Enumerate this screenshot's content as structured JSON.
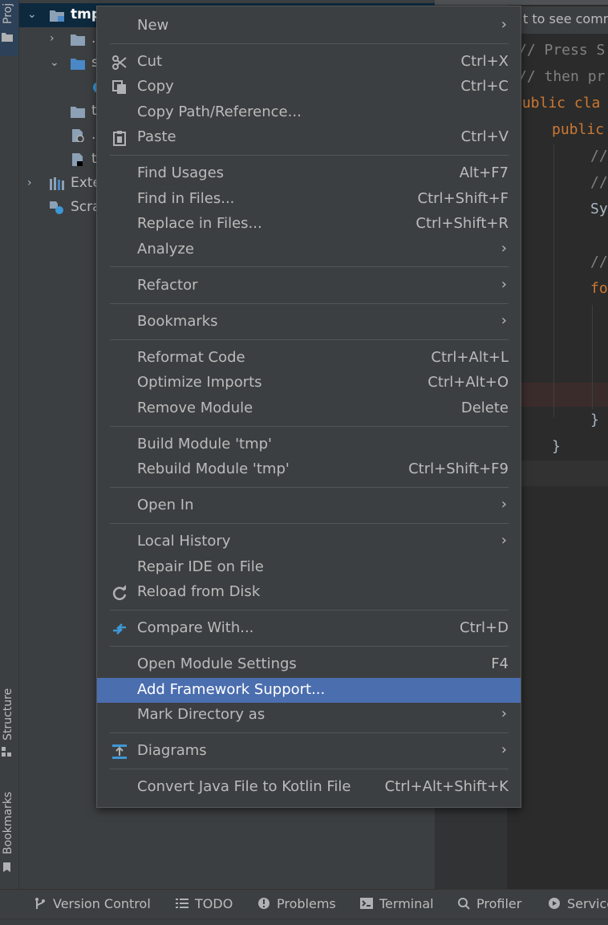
{
  "left_strip": {
    "project_label": "Proj",
    "structure_label": "Structure",
    "bookmarks_label": "Bookmarks"
  },
  "project_tree": {
    "root_label": "tmp",
    "row_idea": ".",
    "row_src": "s",
    "row_out": "t",
    "row_iml": ".",
    "row_tmp_file": "t",
    "external_libraries": "Exte",
    "scratches": "Scra"
  },
  "editor": {
    "hint": "t to see comm",
    "lines": [
      "// Press S",
      "// then pr",
      "public cla",
      "public",
      "//",
      "//",
      "Sy",
      "//",
      "fo",
      "}",
      "}"
    ]
  },
  "context_menu": {
    "items": [
      {
        "label": "New",
        "shortcut": "",
        "submenu": true,
        "icon": ""
      },
      {
        "label": "Cut",
        "shortcut": "Ctrl+X",
        "submenu": false,
        "icon": "scissors-icon"
      },
      {
        "label": "Copy",
        "shortcut": "Ctrl+C",
        "submenu": false,
        "icon": "copy-icon"
      },
      {
        "label": "Copy Path/Reference...",
        "shortcut": "",
        "submenu": false,
        "icon": ""
      },
      {
        "label": "Paste",
        "shortcut": "Ctrl+V",
        "submenu": false,
        "icon": "clipboard-icon"
      },
      {
        "label": "Find Usages",
        "shortcut": "Alt+F7",
        "submenu": false,
        "icon": ""
      },
      {
        "label": "Find in Files...",
        "shortcut": "Ctrl+Shift+F",
        "submenu": false,
        "icon": ""
      },
      {
        "label": "Replace in Files...",
        "shortcut": "Ctrl+Shift+R",
        "submenu": false,
        "icon": ""
      },
      {
        "label": "Analyze",
        "shortcut": "",
        "submenu": true,
        "icon": ""
      },
      {
        "label": "Refactor",
        "shortcut": "",
        "submenu": true,
        "icon": ""
      },
      {
        "label": "Bookmarks",
        "shortcut": "",
        "submenu": true,
        "icon": ""
      },
      {
        "label": "Reformat Code",
        "shortcut": "Ctrl+Alt+L",
        "submenu": false,
        "icon": ""
      },
      {
        "label": "Optimize Imports",
        "shortcut": "Ctrl+Alt+O",
        "submenu": false,
        "icon": ""
      },
      {
        "label": "Remove Module",
        "shortcut": "Delete",
        "submenu": false,
        "icon": ""
      },
      {
        "label": "Build Module 'tmp'",
        "shortcut": "",
        "submenu": false,
        "icon": ""
      },
      {
        "label": "Rebuild Module 'tmp'",
        "shortcut": "Ctrl+Shift+F9",
        "submenu": false,
        "icon": ""
      },
      {
        "label": "Open In",
        "shortcut": "",
        "submenu": true,
        "icon": ""
      },
      {
        "label": "Local History",
        "shortcut": "",
        "submenu": true,
        "icon": ""
      },
      {
        "label": "Repair IDE on File",
        "shortcut": "",
        "submenu": false,
        "icon": ""
      },
      {
        "label": "Reload from Disk",
        "shortcut": "",
        "submenu": false,
        "icon": "reload-icon"
      },
      {
        "label": "Compare With...",
        "shortcut": "Ctrl+D",
        "submenu": false,
        "icon": "compare-icon"
      },
      {
        "label": "Open Module Settings",
        "shortcut": "F4",
        "submenu": false,
        "icon": ""
      },
      {
        "label": "Add Framework Support...",
        "shortcut": "",
        "submenu": false,
        "icon": "",
        "selected": true
      },
      {
        "label": "Mark Directory as",
        "shortcut": "",
        "submenu": true,
        "icon": ""
      },
      {
        "label": "Diagrams",
        "shortcut": "",
        "submenu": true,
        "icon": "diagram-icon"
      },
      {
        "label": "Convert Java File to Kotlin File",
        "shortcut": "Ctrl+Alt+Shift+K",
        "submenu": false,
        "icon": ""
      }
    ],
    "submenu_arrow": "›",
    "selected_color": "#4b6eaf"
  },
  "bottom_bar": {
    "tabs": [
      {
        "label": "Version Control",
        "icon": "branch-icon"
      },
      {
        "label": "TODO",
        "icon": "list-icon"
      },
      {
        "label": "Problems",
        "icon": "warning-icon"
      },
      {
        "label": "Terminal",
        "icon": "terminal-icon"
      },
      {
        "label": "Profiler",
        "icon": "profiler-icon"
      },
      {
        "label": "Service",
        "icon": "services-icon"
      }
    ]
  }
}
